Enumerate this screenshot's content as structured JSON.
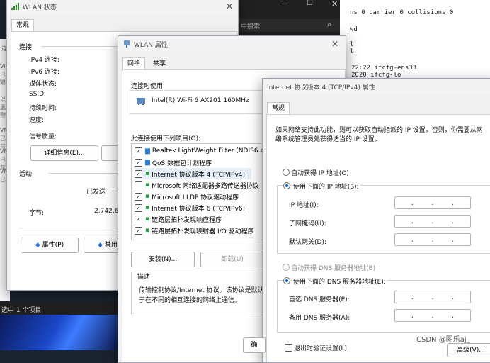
{
  "colors": {
    "desktop": "#1b2330",
    "accent": "#0a5bc4"
  },
  "status_window": {
    "title": "WLAN 状态",
    "tab": "常规",
    "connection_heading": "连接",
    "fields": [
      "IPv4 连接:",
      "IPv6 连接:",
      "媒体状态:",
      "SSID:",
      "持续时间:",
      "速度:"
    ],
    "signal_label": "信号质量:",
    "details_button": "详细信息(E)...",
    "activity_heading": "活动",
    "sent_label": "已发送",
    "bytes_label": "字节:",
    "bytes_value": "2,742,6",
    "properties_button": "属性(P)",
    "disable_button": "禁用(D)"
  },
  "left_edge_fragments": [
    "连",
    "Vir",
    "已禁",
    "Vir",
    "以太",
    "已禁",
    "Rea",
    "VM",
    "已禁",
    "VM",
    "已禁",
    "VM",
    "已"
  ],
  "explorer": {
    "search_placeholder": "中搜索",
    "status": "选中 1 个项目"
  },
  "terminal": {
    "lines": [
      "ns 0  carrier 0  collisions 0",
      "wd",
      "l",
      "l",
      "22:22 ifcfg-ens33",
      "2020 ifcfg-lo"
    ]
  },
  "props_window": {
    "title": "WLAN 属性",
    "tabs": [
      "网络",
      "共享"
    ],
    "connect_using_label": "连接时使用:",
    "adapter": "Intel(R) Wi-Fi 6 AX201 160MHz",
    "items_label": "此连接使用下列项目(O):",
    "items": [
      {
        "label": "Realtek LightWeight Filter (NDIS6.4",
        "checked": true
      },
      {
        "label": "QoS 数据包计划程序",
        "checked": true
      },
      {
        "label": "Internet 协议版本 4 (TCP/IPv4)",
        "checked": true
      },
      {
        "label": "Microsoft 网络适配器多路传送器协议",
        "checked": false
      },
      {
        "label": "Microsoft LLDP 协议驱动程序",
        "checked": true
      },
      {
        "label": "Internet 协议版本 6 (TCP/IPv6)",
        "checked": true
      },
      {
        "label": "链路层拓扑发现响应程序",
        "checked": true
      },
      {
        "label": "链路层拓扑发现映射器 I/O 驱动程序",
        "checked": true
      }
    ],
    "install_button": "安装(N)...",
    "uninstall_button": "卸载(U)",
    "description_heading": "描述",
    "description_line1": "传输控制协议/Internet 协议。该协议是默认",
    "description_line2": "于在不同的相互连接的网络上通信。"
  },
  "ipv4_window": {
    "title": "Internet 协议版本 4 (TCP/IPv4) 属性",
    "tab": "常规",
    "intro_line1": "如果网络支持此功能，则可以获取自动指派的 IP 设置。否则，你需要从网",
    "intro_line2": "络系统管理员处获得适当的 IP 设置。",
    "auto_ip": "自动获得 IP 地址(O)",
    "manual_ip": "使用下面的 IP 地址(S):",
    "ip_label": "IP 地址(I):",
    "mask_label": "子网掩码(U):",
    "gateway_label": "默认网关(D):",
    "auto_dns": "自动获得 DNS 服务器地址(B)",
    "manual_dns": "使用下面的 DNS 服务器地址(E):",
    "dns1_label": "首选 DNS 服务器(P):",
    "dns2_label": "备用 DNS 服务器(A):",
    "validate_label": "退出时验证设置(L)",
    "advanced_button": "高级(V)..."
  },
  "behind_button_fragment": "确",
  "watermark": "CSDN @图乐aj_"
}
